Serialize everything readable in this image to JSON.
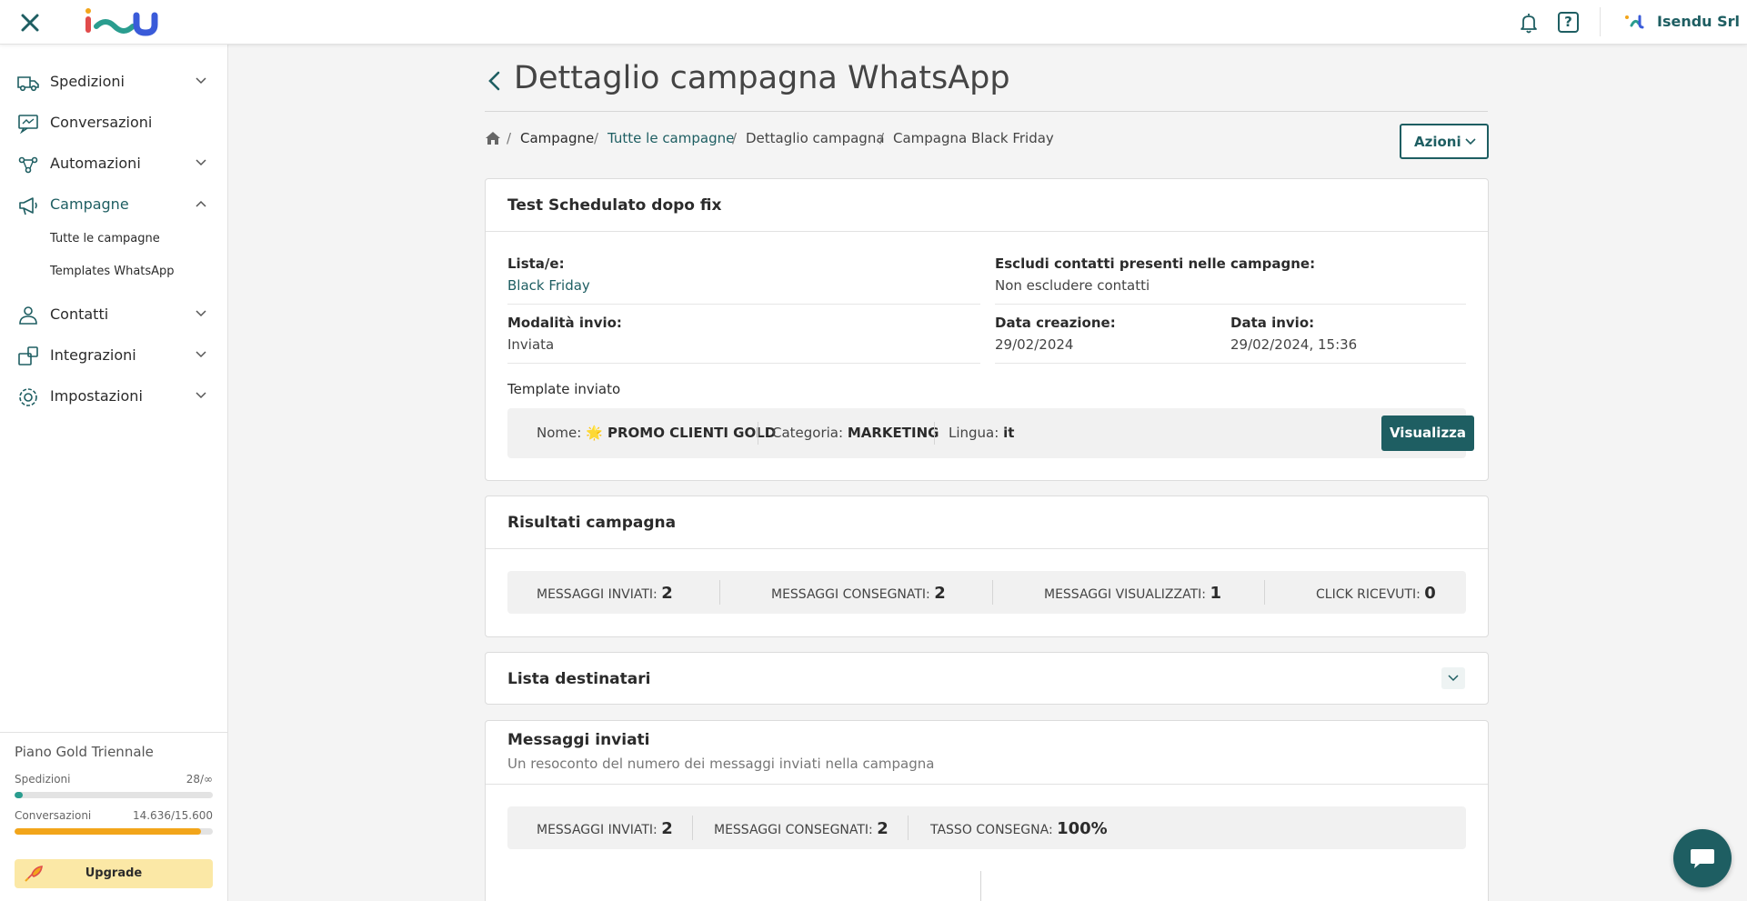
{
  "topbar": {
    "organization": "Isendu Srl",
    "icons": [
      "close-icon",
      "isendu-logo",
      "bell-icon",
      "help-icon",
      "organization-icon"
    ]
  },
  "sidebar": {
    "items": [
      {
        "label": "Spedizioni",
        "icon": "truck-icon",
        "expandable": true
      },
      {
        "label": "Conversazioni",
        "icon": "chat-icon",
        "expandable": false
      },
      {
        "label": "Automazioni",
        "icon": "automation-icon",
        "expandable": true
      },
      {
        "label": "Campagne",
        "icon": "megaphone-icon",
        "expandable": true,
        "active": true
      },
      {
        "label": "Contatti",
        "icon": "contacts-icon",
        "expandable": true
      },
      {
        "label": "Integrazioni",
        "icon": "integrations-icon",
        "expandable": true
      },
      {
        "label": "Impostazioni",
        "icon": "settings-icon",
        "expandable": true
      }
    ],
    "subitems": [
      "Tutte le campagne",
      "Templates WhatsApp"
    ],
    "plan": {
      "title": "Piano Gold Triennale",
      "rows": [
        {
          "label": "Spedizioni",
          "value": "28/∞",
          "fraction": 0.04,
          "color": "#2a9d8f"
        },
        {
          "label": "Conversazioni",
          "value": "14.636/15.600",
          "fraction": 0.94,
          "color": "#f2a51a"
        }
      ],
      "upgrade_label": "Upgrade"
    }
  },
  "page": {
    "title": "Dettaglio campagna WhatsApp",
    "breadcrumb": [
      "Campagne",
      "Tutte le campagne",
      "Dettaglio campagna",
      "Campagna Black Friday"
    ],
    "actions_label": "Azioni"
  },
  "campaign": {
    "name": "Test Schedulato dopo fix",
    "lists_label": "Lista/e:",
    "lists_value": "Black Friday",
    "exclude_label": "Escludi contatti presenti nelle campagne:",
    "exclude_value": "Non escludere contatti",
    "mode_label": "Modalità invio:",
    "mode_value": "Inviata",
    "created_label": "Data creazione:",
    "created_value": "29/02/2024",
    "sent_label": "Data invio:",
    "sent_value": "29/02/2024, 15:36",
    "template_heading": "Template inviato",
    "template": {
      "name_label": "Nome:",
      "name_value": "🌟 PROMO CLIENTI GOLD",
      "category_label": "Categoria:",
      "category_value": "MARKETING",
      "language_label": "Lingua:",
      "language_value": "it",
      "view_label": "Visualizza"
    }
  },
  "results": {
    "title": "Risultati campagna",
    "stats": [
      {
        "label": "MESSAGGI INVIATI:",
        "value": "2"
      },
      {
        "label": "MESSAGGI CONSEGNATI:",
        "value": "2"
      },
      {
        "label": "MESSAGGI VISUALIZZATI:",
        "value": "1"
      },
      {
        "label": "CLICK RICEVUTI:",
        "value": "0"
      }
    ]
  },
  "recipients": {
    "title": "Lista destinatari"
  },
  "messages": {
    "title": "Messaggi inviati",
    "subtitle": "Un resoconto del numero dei messaggi inviati nella campagna",
    "stats": [
      {
        "label": "MESSAGGI INVIATI:",
        "value": "2"
      },
      {
        "label": "MESSAGGI CONSEGNATI:",
        "value": "2"
      },
      {
        "label": "TASSO CONSEGNA:",
        "value": "100%"
      }
    ]
  },
  "colors": {
    "brand": "#1e5e62",
    "background": "#f4f4f4",
    "upgrade": "#fbe8a6"
  }
}
